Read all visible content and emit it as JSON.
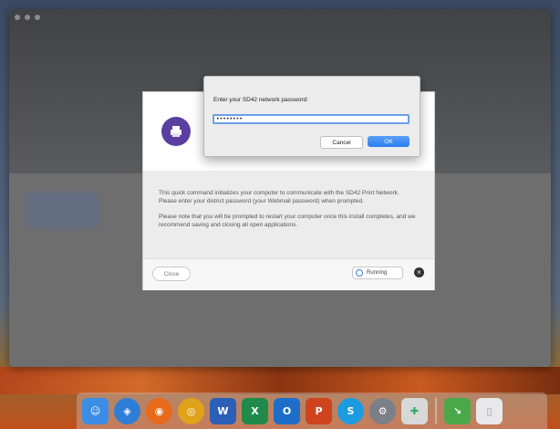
{
  "dialog": {
    "prompt": "Enter your SD42 network password:",
    "password_value": "••••••••",
    "cancel_label": "Cancel",
    "ok_label": "OK"
  },
  "installer": {
    "message_p1": "This quick command initializes your computer to communicate with the SD42 Print Network.",
    "message_p2": "Please enter your district password (your Webmail password) when prompted.",
    "message_p3": "Please note that you will be prompted to restart your computer once this install completes, and we recommend saving and closing all open applications.",
    "close_label": "Close",
    "status_label": "Running"
  },
  "dock": {
    "icons": [
      "finder-icon",
      "safari-icon",
      "firefox-icon",
      "chrome-icon",
      "word-icon",
      "excel-icon",
      "outlook-icon",
      "powerpoint-icon",
      "skype-icon",
      "system-preferences-icon",
      "self-service-icon",
      "downloads-icon",
      "trash-icon"
    ]
  },
  "colors": {
    "accent_purple": "#5a3fa0",
    "ok_blue": "#2a7ef0",
    "field_focus": "#6aa0e6"
  }
}
